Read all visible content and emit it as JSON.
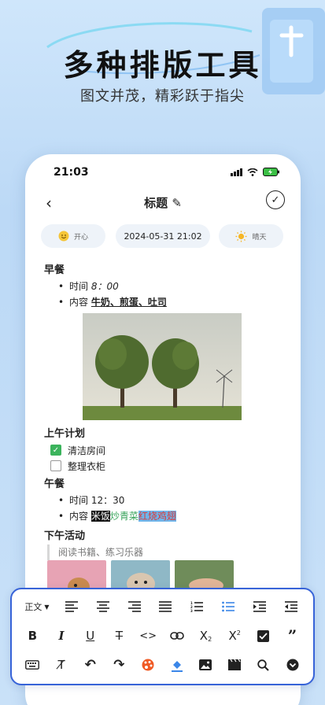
{
  "promo": {
    "title": "多种排版工具",
    "subtitle": "图文并茂，精彩跃于指尖"
  },
  "status_bar": {
    "time": "21:03"
  },
  "nav": {
    "title": "标题"
  },
  "meta": {
    "mood_label": "开心",
    "date": "2024-05-31 21:02",
    "weather_label": "晴天"
  },
  "note": {
    "breakfast_heading": "早餐",
    "breakfast_time_prefix": "时间",
    "breakfast_time_value": "8：00",
    "breakfast_content_prefix": "内容",
    "breakfast_content_value": "牛奶、煎蛋、吐司",
    "morning_heading": "上午计划",
    "task_1": "清洁房间",
    "task_1_done": true,
    "task_2": "整理衣柜",
    "task_2_done": false,
    "lunch_heading": "午餐",
    "lunch_time_line": "时间 12：30",
    "lunch_content_prefix": "内容",
    "lunch_item_1": "米饭",
    "lunch_item_2": "炒青菜",
    "lunch_item_3": "红烧鸡翅",
    "afternoon_heading": "下午活动",
    "afternoon_quote": "阅读书籍、练习乐器"
  },
  "toolbar": {
    "style_label": "正文",
    "accent_color": "#3a86e8",
    "border_color": "#3763d8",
    "row1": [
      "align-left-icon",
      "align-center-icon",
      "align-right-icon",
      "align-justify-icon",
      "ordered-list-icon",
      "bullet-list-icon",
      "indent-icon",
      "outdent-icon"
    ],
    "row2": [
      "bold-icon",
      "italic-icon",
      "underline-icon",
      "strikethrough-icon",
      "code-icon",
      "link-icon",
      "subscript-icon",
      "superscript-icon",
      "checkbox-icon",
      "quote-icon"
    ],
    "row3": [
      "keyboard-icon",
      "clear-format-icon",
      "undo-icon",
      "redo-icon",
      "palette-icon",
      "fill-color-icon",
      "image-icon",
      "video-icon",
      "search-icon",
      "collapse-icon"
    ]
  }
}
